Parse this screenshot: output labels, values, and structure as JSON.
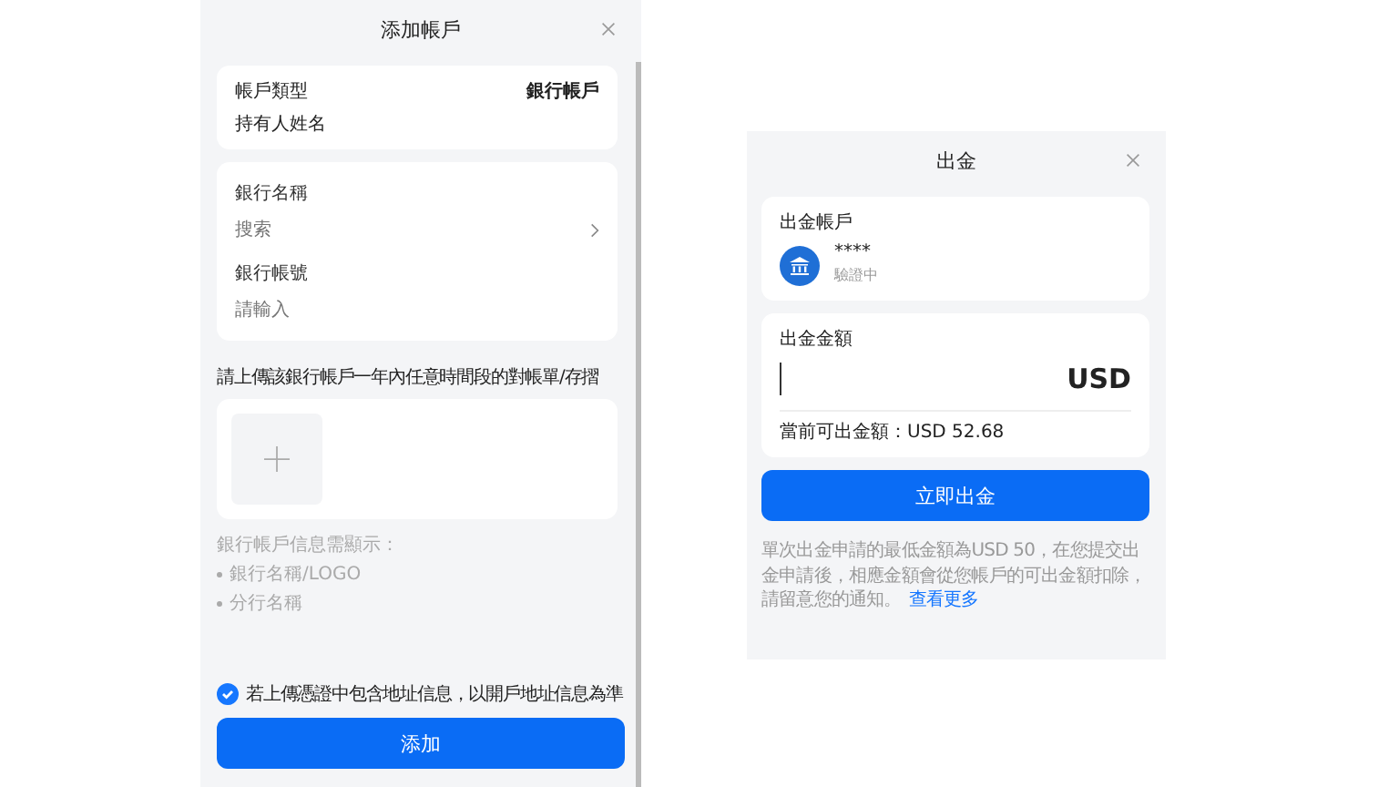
{
  "add_account": {
    "title": "添加帳戶",
    "account_type_label": "帳戶類型",
    "account_type_value": "銀行帳戶",
    "holder_name_label": "持有人姓名",
    "bank_name": {
      "label": "銀行名稱",
      "placeholder": "搜索"
    },
    "bank_account": {
      "label": "銀行帳號",
      "placeholder": "請輸入"
    },
    "upload_label": "請上傳該銀行帳戶一年內任意時間段的對帳單/存摺",
    "requirements_title": "銀行帳戶信息需顯示：",
    "requirements": [
      "銀行名稱/LOGO",
      "分行名稱"
    ],
    "address_confirm": {
      "label": "若上傳憑證中包含地址信息，以開戶地址信息為準",
      "checked": true
    },
    "submit": "添加"
  },
  "withdraw": {
    "title": "出金",
    "account_label": "出金帳戶",
    "account_masked": "****",
    "account_status": "驗證中",
    "amount_label": "出金金額",
    "currency": "USD",
    "available": "當前可出金額：USD 52.68",
    "submit": "立即出金",
    "note": "單次出金申請的最低金額為USD 50，在您提交出金申請後，相應金額會從您帳戶的可出金額扣除，請留意您的通知。",
    "more_link": "查看更多"
  }
}
